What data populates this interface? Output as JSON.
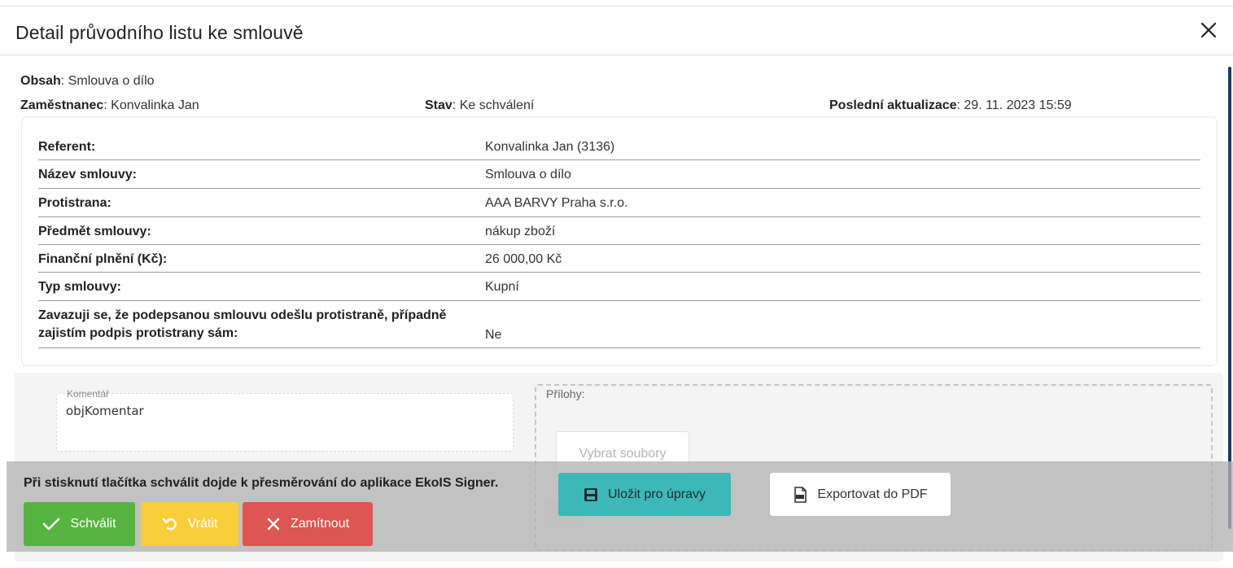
{
  "dialog": {
    "title": "Detail průvodního listu ke smlouvě"
  },
  "summary": {
    "obsah_label": "Obsah",
    "obsah_value": "Smlouva o dílo",
    "employee_label": "Zaměstnanec",
    "employee_value": "Konvalinka Jan",
    "status_label": "Stav",
    "status_value": "Ke schválení",
    "updated_label": "Poslední aktualizace",
    "updated_value": "29. 11. 2023 15:59"
  },
  "details": [
    {
      "label": "Referent:",
      "value": "Konvalinka Jan (3136)"
    },
    {
      "label": "Název smlouvy:",
      "value": "Smlouva o dílo"
    },
    {
      "label": "Protistrana:",
      "value": "AAA BARVY Praha s.r.o."
    },
    {
      "label": "Předmět smlouvy:",
      "value": "nákup zboží"
    },
    {
      "label": "Finanční plnění (Kč):",
      "value": "26 000,00 Kč"
    },
    {
      "label": "Typ smlouvy:",
      "value": "Kupní"
    },
    {
      "label_line1": "Zavazuji se, že podepsanou smlouvu odešlu protistraně, případně",
      "label_line2": "zajistím podpis protistrany sám:",
      "value": "Ne"
    }
  ],
  "comment": {
    "label": "Komentář",
    "value": "objKomentar"
  },
  "attachments": {
    "label": "Přílohy:",
    "choose_button": "Vybrat soubory"
  },
  "notice": "Při stisknutí tlačítka schválit dojde k přesměrování do aplikace EkoIS Signer.",
  "actions": {
    "approve": "Schválit",
    "return": "Vrátit",
    "reject": "Zamítnout",
    "save": "Uložit pro úpravy",
    "export": "Exportovat do PDF"
  },
  "icons": {
    "close": "close-icon",
    "approve": "check-icon",
    "return": "undo-icon",
    "reject": "x-icon",
    "save": "floppy-icon",
    "export": "pdf-icon"
  },
  "colors": {
    "approve": "#57b440",
    "return": "#f8cf3b",
    "reject": "#dd5651",
    "save": "#3cb8b8",
    "scrollbar": "#1d3a64"
  }
}
